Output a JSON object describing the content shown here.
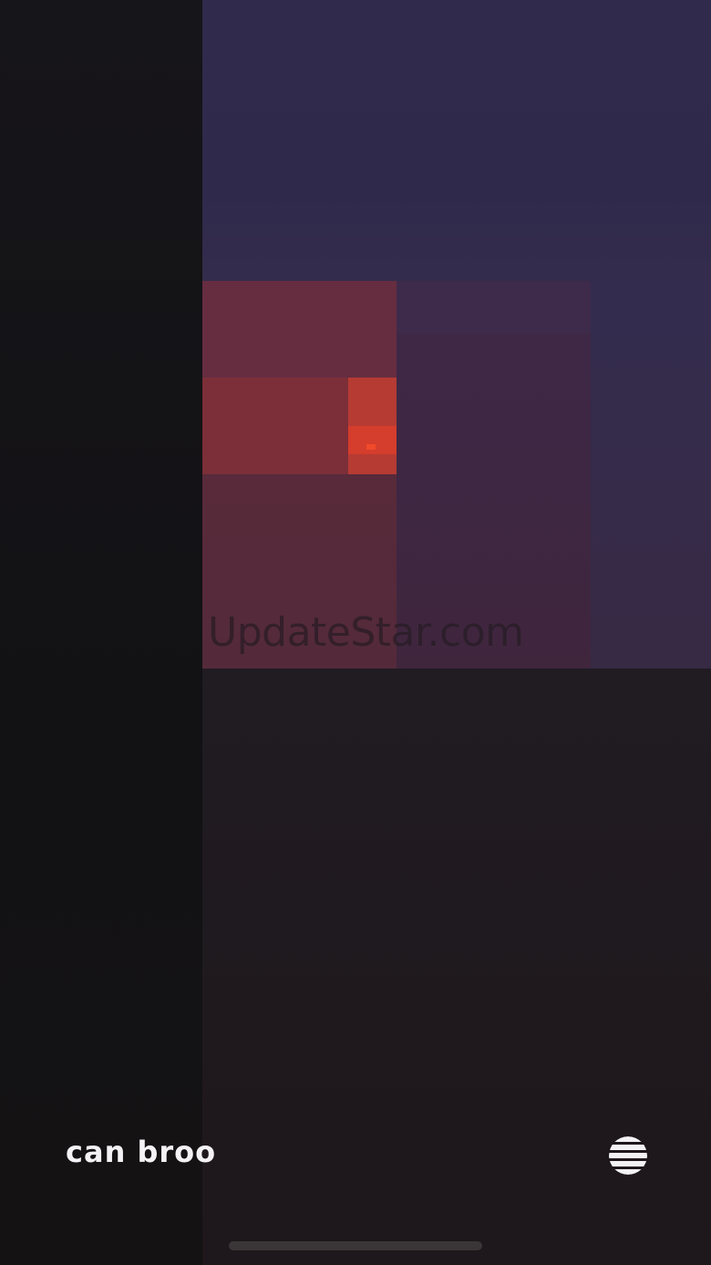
{
  "watermark": {
    "text": "UpdateStar.com"
  },
  "footer": {
    "brand_label": "can broo",
    "menu_icon": "striped-circle-menu-icon"
  },
  "colors": {
    "background": "#141316",
    "top_block": "#302a4d",
    "red_block": "#662d40",
    "orange_block": "#b63b33",
    "orange_core": "#d53d2c",
    "purple_block": "#3e2848",
    "indigo_block": "#342c4f",
    "brand_text": "#f4f2f4"
  }
}
